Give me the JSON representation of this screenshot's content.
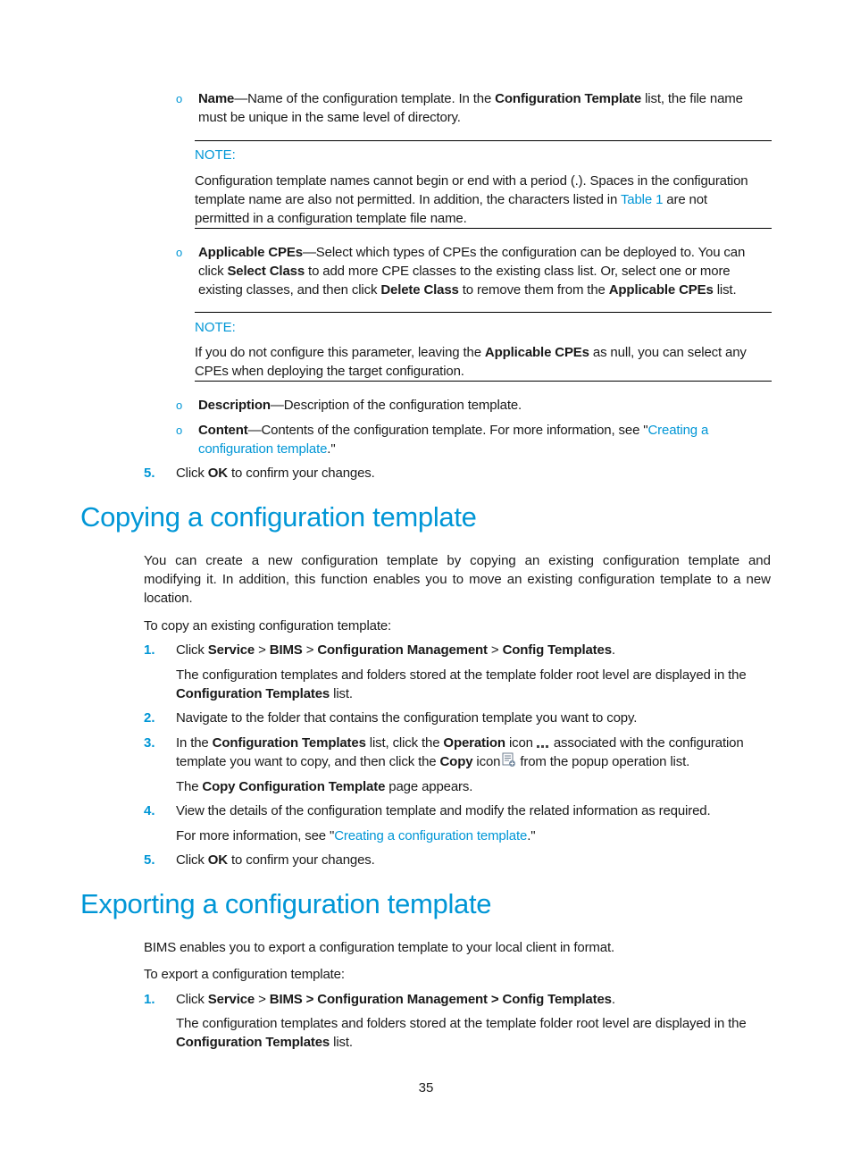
{
  "page_number": "35",
  "colors": {
    "accent": "#0096d6",
    "text": "#1a1a1a",
    "rule": "#000000"
  },
  "top_section": {
    "name_item": {
      "term": "Name",
      "text1": "—Name of the configuration template. In the ",
      "bold1": "Configuration Template",
      "text2": " list, the file name",
      "line2": "must be unique in the same level of directory."
    },
    "note1": {
      "label": "NOTE:",
      "line1": "Configuration template names cannot begin or end with a period (.). Spaces in the configuration",
      "line2_a": "template name are also not permitted. In addition, the characters listed in ",
      "line2_link": "Table 1",
      "line2_b": " are not",
      "line3": "permitted in a configuration template file name."
    },
    "cpes_item": {
      "term": "Applicable CPEs",
      "line1": "—Select which types of CPEs the configuration can be deployed to. You can",
      "line2_a": "click ",
      "line2_bold": "Select Class",
      "line2_b": " to add more CPE classes to the existing class list. Or, select one or more",
      "line3_a": "existing classes, and then click ",
      "line3_bold1": "Delete Class",
      "line3_b": " to remove them from the ",
      "line3_bold2": "Applicable CPEs",
      "line3_c": " list."
    },
    "note2": {
      "label": "NOTE:",
      "line1_a": "If you do not configure this parameter, leaving the ",
      "line1_bold": "Applicable CPEs",
      "line1_b": " as null, you can select any",
      "line2": "CPEs when deploying the target configuration."
    },
    "description_item": {
      "term": "Description",
      "text": "—Description of the configuration template."
    },
    "content_item": {
      "term": "Content",
      "text": "—Contents of the configuration template. For more information, see \"",
      "link1": "Creating a",
      "link2": "configuration template",
      "tail": ".\""
    },
    "step5": {
      "num": "5.",
      "a": "Click ",
      "bold": "OK",
      "b": " to confirm your changes."
    }
  },
  "copying": {
    "heading": "Copying a configuration template",
    "intro_line1": "You can create a new configuration template by copying an existing configuration template and",
    "intro_line2": "modifying it. In addition, this function enables you to move an existing configuration template to a new",
    "intro_line3": "location.",
    "lead": "To copy an existing configuration template:",
    "steps": [
      {
        "num": "1.",
        "a": "Click ",
        "b1": "Service",
        "sep1": " > ",
        "b2": "BIMS",
        "sep2": " > ",
        "b3": "Configuration Management",
        "sep3": " > ",
        "b4": "Config Templates",
        "end": ".",
        "sub_line1": "The configuration templates and folders stored at the template folder root level are displayed in the",
        "sub_bold": "Configuration Templates",
        "sub_tail": " list."
      },
      {
        "num": "2.",
        "text": "Navigate to the folder that contains the configuration template you want to copy."
      },
      {
        "num": "3.",
        "a": "In the ",
        "b1": "Configuration Templates",
        "c": " list, click the ",
        "b2": "Operation",
        "d": " icon",
        "e": "associated with the configuration",
        "line2_a": "template you want to copy, and then click the ",
        "line2_bold": "Copy",
        "line2_b": " icon",
        "line2_c": "from the popup operation list.",
        "operation_icon": "more-dots-icon",
        "copy_icon": "copy-document-icon",
        "sub_a": "The ",
        "sub_bold": "Copy Configuration Template",
        "sub_b": " page appears."
      },
      {
        "num": "4.",
        "text": "View the details of the configuration template and modify the related information as required.",
        "sub_a": "For more information, see \"",
        "sub_link": "Creating a configuration template",
        "sub_b": ".\""
      },
      {
        "num": "5.",
        "a": "Click ",
        "bold": "OK",
        "b": " to confirm your changes."
      }
    ]
  },
  "exporting": {
    "heading": "Exporting a configuration template",
    "intro": "BIMS enables you to export a configuration template to your local client in format.",
    "lead": "To export a configuration template:",
    "steps": [
      {
        "num": "1.",
        "a": "Click ",
        "b1": "Service",
        "sep1": " > ",
        "b2": "BIMS > Configuration Management > Config Templates",
        "end": ".",
        "sub_line1": "The configuration templates and folders stored at the template folder root level are displayed in the",
        "sub_bold": "Configuration Templates",
        "sub_tail": " list."
      }
    ]
  }
}
